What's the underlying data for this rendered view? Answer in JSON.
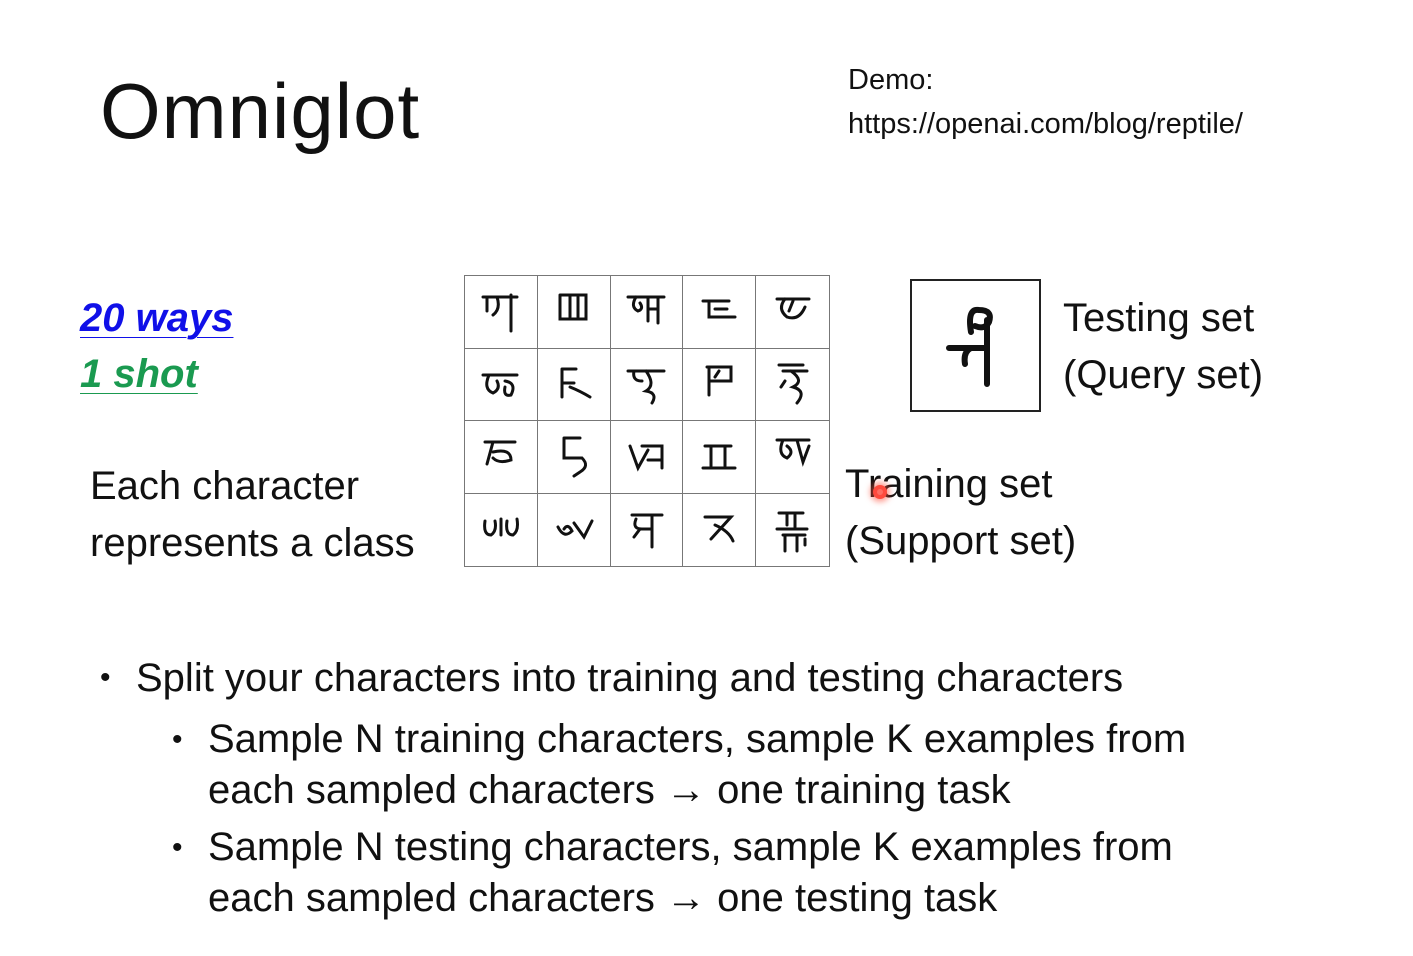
{
  "title": "Omniglot",
  "demo": {
    "label": "Demo:",
    "url": "https://openai.com/blog/reptile/"
  },
  "setting": {
    "ways": "20 ways",
    "shot": "1 shot"
  },
  "class_note": {
    "line1": "Each character",
    "line2": "represents a class"
  },
  "testing": {
    "line1": "Testing set",
    "line2": "(Query set)"
  },
  "training": {
    "line1": "Training set",
    "line2": "(Support set)"
  },
  "bullets": {
    "main": "Split your characters into training and testing characters",
    "sub1_line1": "Sample N training characters, sample K examples from",
    "sub1_line2": "each sampled characters  → one training task",
    "sub2_line1": "Sample N testing characters, sample K examples from",
    "sub2_line2": "each sampled characters  → one testing task"
  },
  "bullet_glyph": "•",
  "colors": {
    "ways": "#1010e8",
    "shot": "#1a9a50",
    "pointer": "#ff4a3d"
  },
  "icons": {
    "grid_cells": "handwritten-character-icon",
    "query": "handwritten-character-icon",
    "cursor": "laser-pointer-icon"
  }
}
